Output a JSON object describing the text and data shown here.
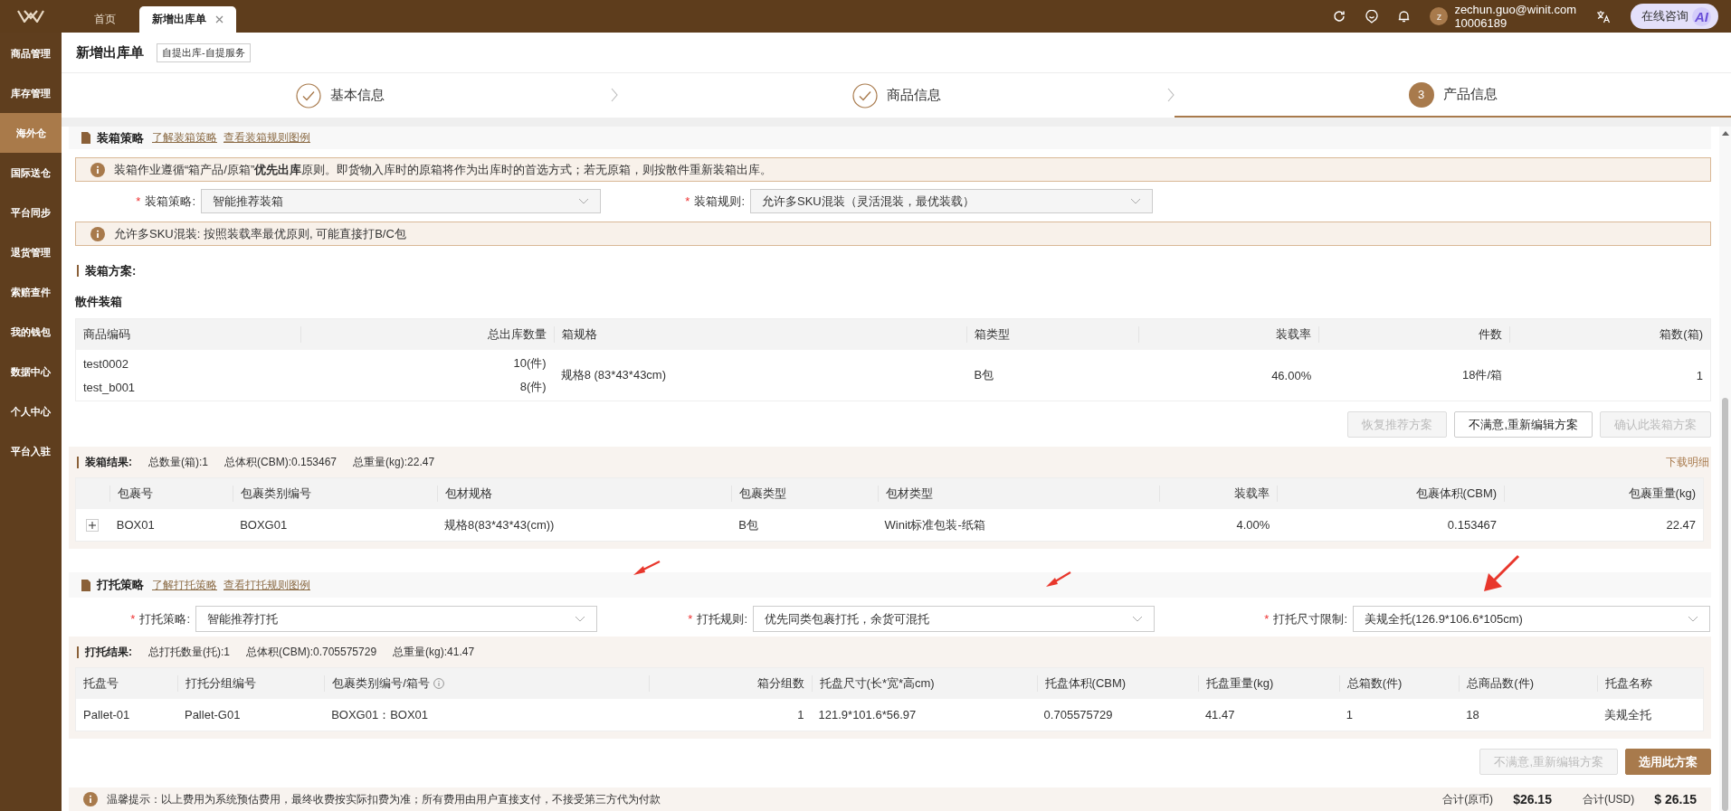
{
  "top_bar": {
    "tabs": [
      {
        "label": "首页",
        "selected": false,
        "closable": false
      },
      {
        "label": "新增出库单",
        "selected": true,
        "closable": true
      }
    ],
    "user": {
      "avatar_letter": "z",
      "email": "zechun.guo@winit.com",
      "account": "10006189"
    },
    "ai_button": {
      "label": "在线咨询",
      "badge": "AI"
    }
  },
  "sidebar": {
    "items": [
      {
        "label": "商品管理",
        "selected": false
      },
      {
        "label": "库存管理",
        "selected": false
      },
      {
        "label": "海外仓",
        "selected": true
      },
      {
        "label": "国际送仓",
        "selected": false
      },
      {
        "label": "平台同步",
        "selected": false
      },
      {
        "label": "退货管理",
        "selected": false
      },
      {
        "label": "索赔查件",
        "selected": false
      },
      {
        "label": "我的钱包",
        "selected": false
      },
      {
        "label": "数据中心",
        "selected": false
      },
      {
        "label": "个人中心",
        "selected": false
      },
      {
        "label": "平台入驻",
        "selected": false
      }
    ]
  },
  "page_header": {
    "title": "新增出库单",
    "tag": "自提出库-自提服务"
  },
  "steps": [
    {
      "label": "基本信息",
      "completed": true,
      "selected": false
    },
    {
      "label": "商品信息",
      "completed": true,
      "selected": false
    },
    {
      "label": "产品信息",
      "completed": false,
      "selected": true,
      "number": "3"
    }
  ],
  "packing": {
    "title": "装箱策略",
    "links": [
      "了解装箱策略",
      "查看装箱规则图例"
    ],
    "notice": "装箱作业遵循“箱产品/原箱”**优先出库**原则。即货物入库时的原箱将作为出库时的首选方式；若无原箱，则按散件重新装箱出库。",
    "fields": [
      {
        "required_mark": "*",
        "label": "装箱策略:",
        "value": "智能推荐装箱"
      },
      {
        "required_mark": "*",
        "label": "装箱规则:",
        "value": "允许多SKU混装（灵活混装，最优装载）"
      }
    ],
    "rule_notice": "允许多SKU混装: 按照装载率最优原则, 可能直接打B/C包",
    "plan_title": "装箱方案:",
    "group_title": "散件装箱",
    "plan_table": {
      "columns": [
        "商品编码",
        "总出库数量",
        "箱规格",
        "箱类型",
        "装载率",
        "件数",
        "箱数(箱)"
      ],
      "items": [
        {
          "cells": [
            "test0002",
            "10(件)"
          ]
        },
        {
          "cells": [
            "test_b001",
            "8(件)"
          ]
        }
      ],
      "shared_cells": [
        "规格8 (83*43*43cm)",
        "B包",
        "46.00%",
        "18件/箱",
        "1"
      ]
    },
    "buttons": [
      {
        "label": "恢复推荐方案",
        "disabled": true,
        "primary": false
      },
      {
        "label": "不满意,重新编辑方案",
        "disabled": false,
        "primary": false
      },
      {
        "label": "确认此装箱方案",
        "disabled": true,
        "primary": false
      }
    ],
    "result_title": "装箱结果:",
    "result_summary": [
      "总数量(箱):1",
      "总体积(CBM):0.153467",
      "总重量(kg):22.47"
    ],
    "download_link": "下载明细",
    "result_table": {
      "columns": [
        "包裹号",
        "包裹类别编号",
        "包材规格",
        "包裹类型",
        "包材类型",
        "装载率",
        "包裹体积(CBM)",
        "包裹重量(kg)"
      ],
      "rows": [
        {
          "expanded": false,
          "cells": [
            "BOX01",
            "BOXG01",
            "规格8(83*43*43(cm))",
            "B包",
            "Winit标准包装-纸箱",
            "4.00%",
            "0.153467",
            "22.47"
          ]
        }
      ]
    }
  },
  "palletizing": {
    "title": "打托策略",
    "links": [
      "了解打托策略",
      "查看打托规则图例"
    ],
    "fields": [
      {
        "required_mark": "*",
        "label": "打托策略:",
        "value": "智能推荐打托"
      },
      {
        "required_mark": "*",
        "label": "打托规则:",
        "value": "优先同类包裹打托，余货可混托"
      },
      {
        "required_mark": "*",
        "label": "打托尺寸限制:",
        "value": "美规全托(126.9*106.6*105cm)"
      }
    ],
    "result_title": "打托结果:",
    "result_summary": [
      "总打托数量(托):1",
      "总体积(CBM):0.705575729",
      "总重量(kg):41.47"
    ],
    "result_table": {
      "columns": [
        "托盘号",
        "打托分组编号",
        "包裹类别编号/箱号",
        "箱分组数",
        "托盘尺寸(长*宽*高cm)",
        "托盘体积(CBM)",
        "托盘重量(kg)",
        "总箱数(件)",
        "总商品数(件)",
        "托盘名称"
      ],
      "rows": [
        {
          "cells": [
            "Pallet-01",
            "Pallet-G01",
            "BOXG01：BOX01",
            "1",
            "121.9*101.6*56.97",
            "0.705575729",
            "41.47",
            "1",
            "18",
            "美规全托"
          ]
        }
      ]
    },
    "buttons": [
      {
        "label": "不满意,重新编辑方案",
        "disabled": true,
        "primary": false
      },
      {
        "label": "选用此方案",
        "disabled": false,
        "primary": true
      }
    ]
  },
  "footer": {
    "tip": "温馨提示：以上费用为系统预估费用，最终收费按实际扣费为准；所有费用由用户直接支付，不接受第三方代为付款",
    "totals": [
      {
        "label": "合计(原币)",
        "value": "$26.15"
      },
      {
        "label": "合计(USD)",
        "value": "$ 26.15"
      }
    ]
  }
}
